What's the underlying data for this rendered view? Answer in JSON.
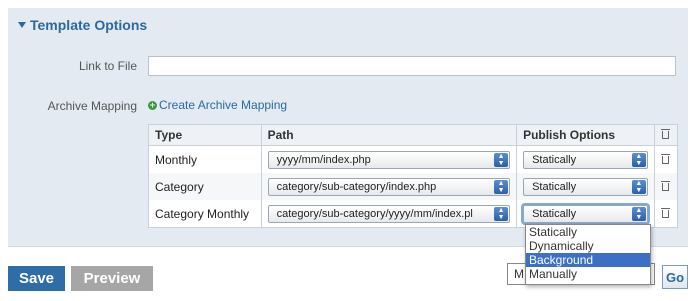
{
  "section": {
    "title": "Template Options"
  },
  "link_to_file": {
    "label": "Link to File",
    "value": ""
  },
  "archive_mapping": {
    "label": "Archive Mapping",
    "create_link": "Create Archive Mapping",
    "columns": [
      "Type",
      "Path",
      "Publish Options"
    ],
    "rows": [
      {
        "type": "Monthly",
        "path": "yyyy/mm/index.php",
        "publish": "Statically"
      },
      {
        "type": "Category",
        "path": "category/sub-category/index.php",
        "publish": "Statically"
      },
      {
        "type": "Category Monthly",
        "path": "category/sub-category/yyyy/mm/index.pl",
        "publish": "Statically"
      }
    ]
  },
  "dropdown": {
    "options": [
      "Statically",
      "Dynamically",
      "Background",
      "Manually"
    ],
    "highlighted": "Background"
  },
  "footer": {
    "save_label": "Save",
    "preview_label": "Preview",
    "more_select_value": "M",
    "go_label": "Go"
  },
  "colors": {
    "accent": "#2c6a9a",
    "save": "#2f6da7",
    "highlight": "#3d70c4"
  }
}
